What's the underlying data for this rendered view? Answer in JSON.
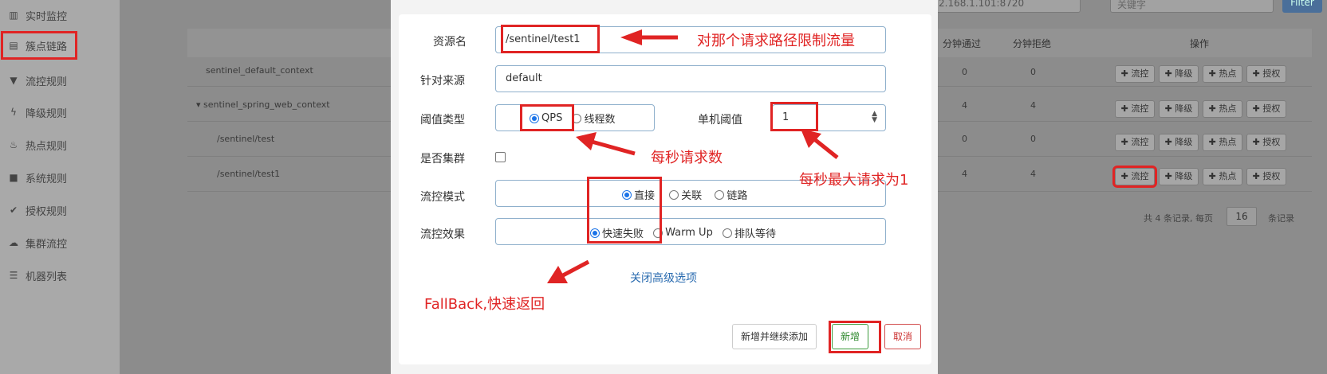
{
  "sidebar": {
    "items": [
      {
        "icon": "chart-icon",
        "glyph": "▥",
        "label": "实时监控"
      },
      {
        "icon": "link-icon",
        "glyph": "▤",
        "label": "簇点链路"
      },
      {
        "icon": "filter-icon",
        "glyph": "▼",
        "label": "流控规则"
      },
      {
        "icon": "bolt-icon",
        "glyph": "ϟ",
        "label": "降级规则"
      },
      {
        "icon": "fire-icon",
        "glyph": "♨",
        "label": "热点规则"
      },
      {
        "icon": "lock-icon",
        "glyph": "■",
        "label": "系统规则"
      },
      {
        "icon": "check-circle-icon",
        "glyph": "✔",
        "label": "授权规则"
      },
      {
        "icon": "cloud-icon",
        "glyph": "☁",
        "label": "集群流控"
      },
      {
        "icon": "list-icon",
        "glyph": "☰",
        "label": "机器列表"
      }
    ]
  },
  "background": {
    "ip_select": "2.168.1.101:8720",
    "search_placeholder": "关键字",
    "search_btn": "Filter",
    "columns": {
      "pass": "分钟通过",
      "reject": "分钟拒绝",
      "ops": "操作"
    },
    "rows": [
      {
        "name": "sentinel_default_context",
        "pass": "0",
        "reject": "0"
      },
      {
        "name": "▾ sentinel_spring_web_context",
        "pass": "4",
        "reject": "4"
      },
      {
        "name": "/sentinel/test",
        "pass": "0",
        "reject": "0"
      },
      {
        "name": "/sentinel/test1",
        "pass": "4",
        "reject": "4"
      }
    ],
    "op_labels": [
      "✚ 流控",
      "✚ 降级",
      "✚ 热点",
      "✚ 授权"
    ],
    "pager_text": "共 4 条记录, 每页",
    "pager_size": "16",
    "pager_suffix": "条记录"
  },
  "form": {
    "resource_label": "资源名",
    "resource_value": "/sentinel/test1",
    "source_label": "针对来源",
    "source_value": "default",
    "threshold_type_label": "阈值类型",
    "threshold_type_options": [
      "QPS",
      "线程数"
    ],
    "threshold_label": "单机阈值",
    "threshold_value": "1",
    "cluster_label": "是否集群",
    "mode_label": "流控模式",
    "mode_options": [
      "直接",
      "关联",
      "链路"
    ],
    "effect_label": "流控效果",
    "effect_options": [
      "快速失败",
      "Warm Up",
      "排队等待"
    ],
    "advanced_link": "关闭高级选项",
    "buttons": {
      "add_continue": "新增并继续添加",
      "add": "新增",
      "cancel": "取消"
    }
  },
  "annotations": {
    "path_limit": "对那个请求路径限制流量",
    "qps_note": "每秒请求数",
    "max_note": "每秒最大请求为1",
    "fallback_note": "FallBack,快速返回"
  },
  "colors": {
    "annotation": "#e02424",
    "primary": "#1a73e8",
    "link": "#2b6cb0"
  }
}
